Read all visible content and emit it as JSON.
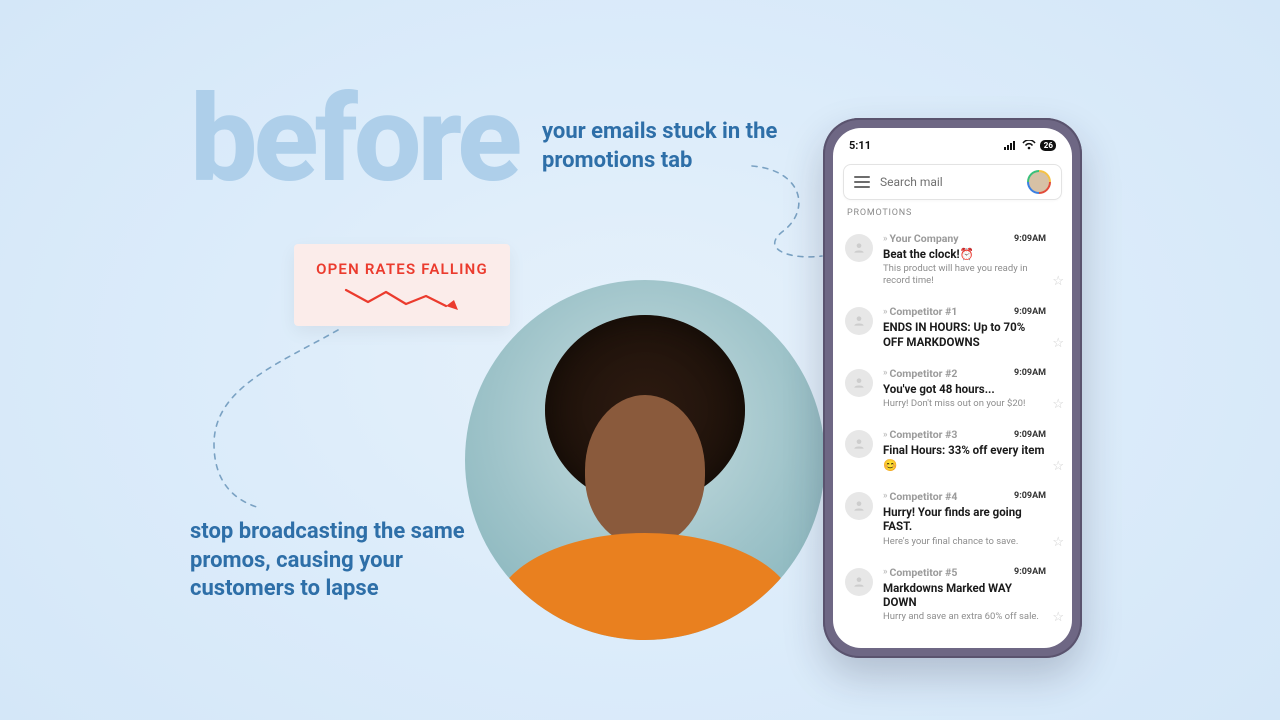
{
  "headline": "before",
  "top_caption": "your emails stuck in the promotions tab",
  "bottom_caption": "stop broadcasting the same promos, causing your customers to lapse",
  "rate_badge": {
    "label": "OPEN RATES FALLING"
  },
  "phone": {
    "time": "5:11",
    "battery": "26",
    "search_placeholder": "Search mail",
    "tab_label": "PROMOTIONS",
    "emails": [
      {
        "sender": "Your Company",
        "time": "9:09AM",
        "subject": "Beat the clock!⏰",
        "preview": "This product will have you ready in record time!"
      },
      {
        "sender": "Competitor #1",
        "time": "9:09AM",
        "subject": "ENDS IN HOURS: Up to 70% OFF MARKDOWNS",
        "preview": ""
      },
      {
        "sender": "Competitor #2",
        "time": "9:09AM",
        "subject": "You've got 48 hours...",
        "preview": "Hurry! Don't miss out on your $20!"
      },
      {
        "sender": "Competitor #3",
        "time": "9:09AM",
        "subject": "Final Hours: 33% off every item 😊",
        "preview": ""
      },
      {
        "sender": "Competitor #4",
        "time": "9:09AM",
        "subject": "Hurry! Your finds are going FAST.",
        "preview": "Here's your final chance to save."
      },
      {
        "sender": "Competitor #5",
        "time": "9:09AM",
        "subject": "Markdowns Marked WAY DOWN",
        "preview": "Hurry and save an extra 60% off sale."
      }
    ]
  }
}
